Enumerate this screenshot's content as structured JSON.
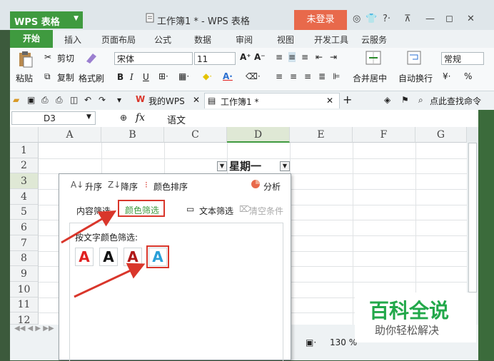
{
  "app": {
    "name": "WPS 表格",
    "doc_title": "工作簿1 * - WPS 表格",
    "login": "未登录"
  },
  "window_controls": {
    "minimize": "—",
    "restore": "◻",
    "close": "✕"
  },
  "ribbon_tabs": [
    "开始",
    "插入",
    "页面布局",
    "公式",
    "数据",
    "审阅",
    "视图",
    "开发工具",
    "云服务"
  ],
  "ribbon": {
    "paste": "粘贴",
    "cut": "剪切",
    "copy": "复制",
    "format_painter": "格式刷",
    "font_name": "宋体",
    "font_size": "11",
    "merge_center": "合并居中",
    "wrap_text": "自动换行",
    "number_format": "常规",
    "percent": "%"
  },
  "docbar": {
    "my_wps": "我的WPS",
    "workbook_tab": "工作簿1 *",
    "find_command": "点此查找命令"
  },
  "formula_bar": {
    "cell_ref": "D3",
    "fx": "fx",
    "content": "语文"
  },
  "grid": {
    "columns": [
      "A",
      "B",
      "C",
      "D",
      "E",
      "F",
      "G"
    ],
    "rows": [
      "1",
      "2",
      "3",
      "4",
      "5",
      "6",
      "7",
      "8",
      "9",
      "10",
      "11",
      "12"
    ],
    "header_cell": "星期一"
  },
  "filter_popup": {
    "sort_asc": "升序",
    "sort_desc": "降序",
    "color_sort": "颜色排序",
    "analysis": "分析",
    "content_filter": "内容筛选",
    "color_filter": "颜色筛选",
    "text_filter": "文本筛选",
    "clear_conditions": "清空条件",
    "font_color_label": "按文字颜色筛选:",
    "font_colors": [
      {
        "letter": "A",
        "color": "#e02020",
        "selected": false
      },
      {
        "letter": "A",
        "color": "#111111",
        "selected": false
      },
      {
        "letter": "A",
        "color": "#b01818",
        "selected": false
      },
      {
        "letter": "A",
        "color": "#2a9fd8",
        "selected": true
      }
    ]
  },
  "status": {
    "zoom": "130 %"
  },
  "watermark": {
    "title": "百科全说",
    "subtitle": "助你轻松解决"
  },
  "colors": {
    "accent_green": "#3f9a3f",
    "login_orange": "#e8694b",
    "highlight_red": "#d9362b"
  }
}
